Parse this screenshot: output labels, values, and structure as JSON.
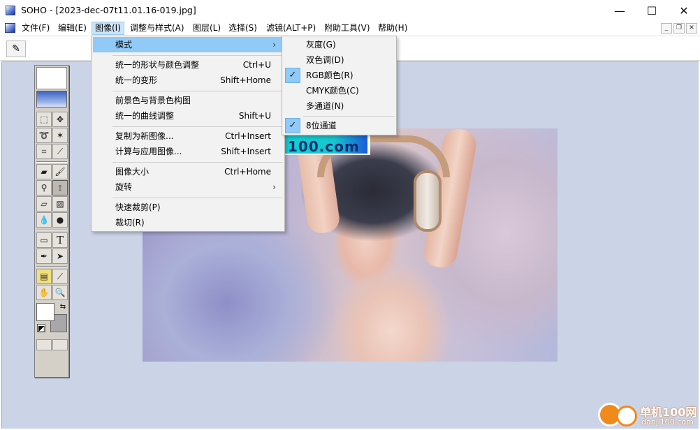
{
  "window": {
    "app_name": "SOHO",
    "title": "SOHO - [2023-dec-07t11.01.16-019.jpg]",
    "minimize_glyph": "—",
    "maximize_glyph": "☐",
    "close_glyph": "✕"
  },
  "menubar": {
    "items": [
      {
        "label": "文件(F)"
      },
      {
        "label": "编辑(E)"
      },
      {
        "label": "图像(I)",
        "active": true
      },
      {
        "label": "调整与样式(A)"
      },
      {
        "label": "图层(L)"
      },
      {
        "label": "选择(S)"
      },
      {
        "label": "滤镜(ALT+P)"
      },
      {
        "label": "附助工具(V)"
      },
      {
        "label": "帮助(H)"
      }
    ],
    "mdi_buttons": [
      "_",
      "❐",
      "✕"
    ]
  },
  "image_menu": {
    "items": [
      {
        "label": "模式",
        "shortcut": "",
        "submenu": true
      },
      {
        "label": "统一的形状与颜色调整",
        "shortcut": "Ctrl+U"
      },
      {
        "label": "统一的变形",
        "shortcut": "Shift+Home"
      },
      {
        "label": "前景色与背景色构图",
        "shortcut": ""
      },
      {
        "label": "统一的曲线调整",
        "shortcut": "Shift+U"
      },
      {
        "label": "复制为新图像...",
        "shortcut": "Ctrl+Insert"
      },
      {
        "label": "计算与应用图像...",
        "shortcut": "Shift+Insert"
      },
      {
        "label": "图像大小",
        "shortcut": "Ctrl+Home"
      },
      {
        "label": "旋转",
        "shortcut": "",
        "submenu": true
      },
      {
        "label": "快速裁剪(P)",
        "shortcut": ""
      },
      {
        "label": "裁切(R)",
        "shortcut": ""
      }
    ],
    "submenu_arrow": "›"
  },
  "mode_submenu": {
    "items": [
      {
        "label": "灰度(G)",
        "checked": false
      },
      {
        "label": "双色调(D)",
        "checked": false
      },
      {
        "label": "RGB颜色(R)",
        "checked": true
      },
      {
        "label": "CMYK颜色(C)",
        "checked": false
      },
      {
        "label": "多通道(N)",
        "checked": false
      },
      {
        "label": "8位通道",
        "checked": true
      }
    ],
    "check_glyph": "✓"
  },
  "toolbox": {
    "tools": [
      {
        "name": "marquee-tool",
        "glyph": "⬚"
      },
      {
        "name": "move-tool",
        "glyph": "✥"
      },
      {
        "name": "lasso-tool",
        "glyph": "➰"
      },
      {
        "name": "magic-wand-tool",
        "glyph": "✶"
      },
      {
        "name": "crop-tool",
        "glyph": "⌗"
      },
      {
        "name": "eyedropper-tool",
        "glyph": "⟋"
      },
      {
        "name": "airbrush-tool",
        "glyph": "▰"
      },
      {
        "name": "brush-tool",
        "glyph": "🖌"
      },
      {
        "name": "stamp-tool",
        "glyph": "⚲"
      },
      {
        "name": "history-brush-tool",
        "glyph": "⟟"
      },
      {
        "name": "eraser-tool",
        "glyph": "▱"
      },
      {
        "name": "gradient-tool",
        "glyph": "▨"
      },
      {
        "name": "blur-tool",
        "glyph": "💧"
      },
      {
        "name": "dodge-tool",
        "glyph": "●"
      },
      {
        "name": "shape-tool",
        "glyph": "▭"
      },
      {
        "name": "text-tool",
        "glyph": "T"
      },
      {
        "name": "pen-tool",
        "glyph": "✒"
      },
      {
        "name": "select-arrow-tool",
        "glyph": "➤"
      },
      {
        "name": "notes-tool",
        "glyph": "▤"
      },
      {
        "name": "color-picker-tool",
        "glyph": "⟋"
      },
      {
        "name": "hand-tool",
        "glyph": "✋"
      },
      {
        "name": "zoom-tool",
        "glyph": "🔍"
      }
    ],
    "swap_glyph": "⇆",
    "default_colors_glyph": "◩",
    "colors": {
      "foreground": "#ffffff",
      "background": "#a8a8a8"
    }
  },
  "toolbar": {
    "preset_glyph": "✎"
  },
  "canvas": {
    "watermark_text": "100.com"
  },
  "site_logo": {
    "name": "单机100网",
    "url": "danji100.com"
  },
  "colors": {
    "workspace": "#cbd4e6",
    "menu_highlight": "#91c9f7",
    "menu_background": "#f2f2f2",
    "logo_orange": "#f08a1c"
  }
}
